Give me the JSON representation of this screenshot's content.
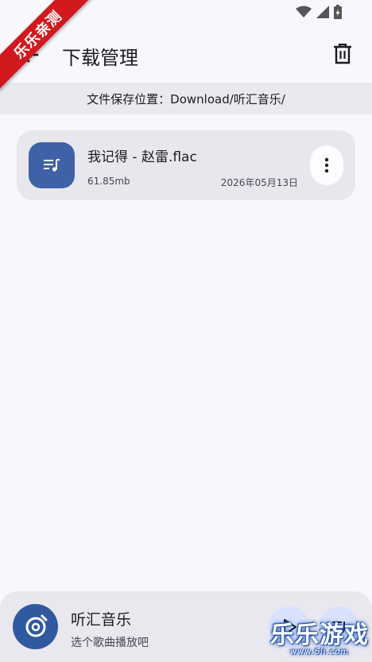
{
  "status_bar": {
    "icons": [
      "wifi-icon",
      "cell-signal-icon",
      "battery-charging-icon"
    ]
  },
  "watermark_ribbon": {
    "text": "乐乐亲测"
  },
  "header": {
    "title": "下载管理",
    "back_icon": "arrow-left-icon",
    "delete_icon": "trash-icon"
  },
  "path_bar": {
    "text": "文件保存位置：Download/听汇音乐/"
  },
  "downloads": [
    {
      "title": "我记得 - 赵雷.flac",
      "size": "61.85mb",
      "date": "2026年05月13日",
      "icon": "music-queue-icon",
      "accent_color": "#3F61A8"
    }
  ],
  "player": {
    "title": "听汇音乐",
    "subtitle": "选个歌曲播放吧",
    "cover_icon": "music-note-icon",
    "buttons": [
      "play-icon",
      "playlist-icon"
    ]
  },
  "watermark": {
    "main": "乐乐游戏",
    "sub": "www.6ll.com"
  },
  "colors": {
    "background": "#F8F7FE",
    "path_bar": "#EAE9F0",
    "card": "#E8E7EE",
    "accent": "#3F61A8",
    "ribbon": "#D2191E"
  }
}
